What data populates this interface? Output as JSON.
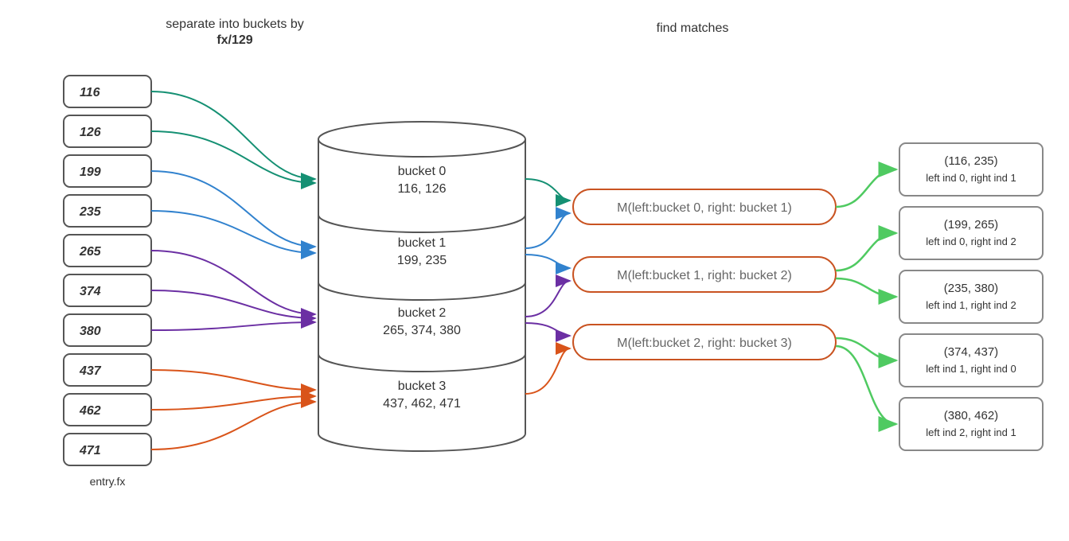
{
  "titles": {
    "sep_line1": "separate into buckets by",
    "sep_line2": "fx/129",
    "find": "find matches",
    "entries_label": "entry.fx"
  },
  "entries": [
    "116",
    "126",
    "199",
    "235",
    "265",
    "374",
    "380",
    "437",
    "462",
    "471"
  ],
  "buckets": [
    {
      "title": "bucket 0",
      "values": "116, 126"
    },
    {
      "title": "bucket 1",
      "values": "199, 235"
    },
    {
      "title": "bucket 2",
      "values": "265, 374, 380"
    },
    {
      "title": "bucket 3",
      "values": "437, 462, 471"
    }
  ],
  "match_ops": [
    "M(left:bucket 0, right: bucket 1)",
    "M(left:bucket 1, right: bucket 2)",
    "M(left:bucket 2, right: bucket 3)"
  ],
  "results": [
    {
      "pair": "(116, 235)",
      "sub": "left ind 0, right ind 1"
    },
    {
      "pair": "(199, 265)",
      "sub": "left ind 0, right ind 2"
    },
    {
      "pair": "(235, 380)",
      "sub": "left ind 1, right ind 2"
    },
    {
      "pair": "(374, 437)",
      "sub": "left ind 1, right ind 0"
    },
    {
      "pair": "(380, 462)",
      "sub": "left ind 2, right ind 1"
    }
  ],
  "colors": {
    "entry_stroke": "#555555",
    "cyl_stroke": "#555555",
    "teal": "#159073",
    "blue": "#3182ce",
    "purple": "#6b2fa3",
    "orange": "#d9541a",
    "match_border": "#c95321",
    "result_green": "#4fca61",
    "result_border": "#888888"
  }
}
